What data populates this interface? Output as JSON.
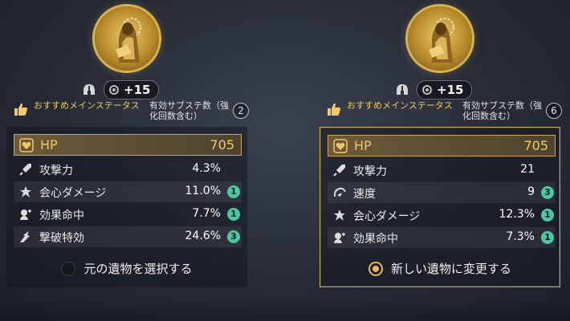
{
  "colors": {
    "accent_gold": "#f3c66b",
    "roll_badge": "#4ec6a0",
    "selected_border": "#c9a65a"
  },
  "panels": [
    {
      "relic_icon": "golden-statue-relic-icon",
      "level": "+15",
      "legend_recommended": "おすすめメインステータス",
      "legend_valid": "有効サブステ数（強化回数含む）",
      "valid_count": "2",
      "main_stat": {
        "name": "HP",
        "value": "705",
        "icon": "heart-icon"
      },
      "sub_stats": [
        {
          "name": "攻撃力",
          "value": "4.3%",
          "rolls": "",
          "icon": "sword-icon"
        },
        {
          "name": "会心ダメージ",
          "value": "11.0%",
          "rolls": "1",
          "icon": "crit-icon"
        },
        {
          "name": "効果命中",
          "value": "7.7%",
          "rolls": "1",
          "icon": "effect-hit-icon"
        },
        {
          "name": "撃破特効",
          "value": "24.6%",
          "rolls": "3",
          "icon": "break-icon"
        }
      ],
      "select_label": "元の遺物を選択する",
      "selected": false
    },
    {
      "relic_icon": "golden-statue-relic-icon",
      "level": "+15",
      "legend_recommended": "おすすめメインステータス",
      "legend_valid": "有効サブステ数（強化回数含む）",
      "valid_count": "6",
      "main_stat": {
        "name": "HP",
        "value": "705",
        "icon": "heart-icon"
      },
      "sub_stats": [
        {
          "name": "攻撃力",
          "value": "21",
          "rolls": "",
          "icon": "sword-icon"
        },
        {
          "name": "速度",
          "value": "9",
          "rolls": "3",
          "icon": "speed-icon"
        },
        {
          "name": "会心ダメージ",
          "value": "12.3%",
          "rolls": "1",
          "icon": "crit-icon"
        },
        {
          "name": "効果命中",
          "value": "7.3%",
          "rolls": "1",
          "icon": "effect-hit-icon"
        }
      ],
      "select_label": "新しい遺物に変更する",
      "selected": true
    }
  ]
}
